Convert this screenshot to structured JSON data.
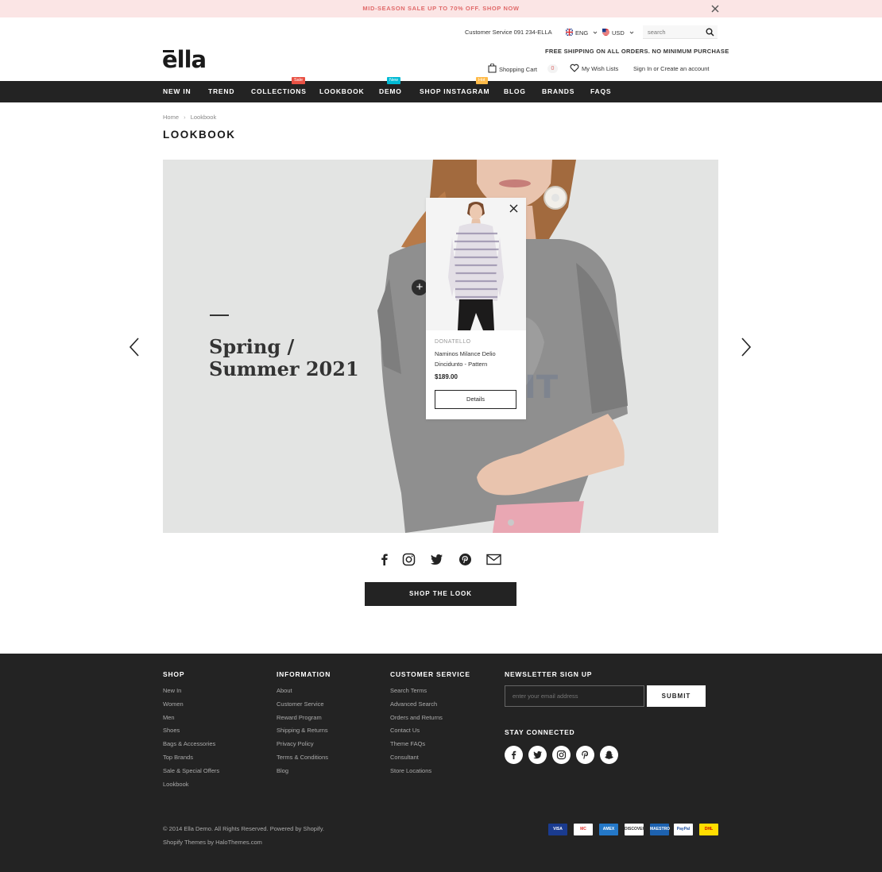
{
  "promo": {
    "text": "MID-SEASON SALE UP TO 70% OFF. SHOP NOW"
  },
  "header": {
    "customer_service": "Customer Service 091 234-ELLA",
    "language": "ENG",
    "currency": "USD",
    "search_placeholder": "search",
    "free_shipping": "FREE SHIPPING ON ALL ORDERS. NO MINIMUM PURCHASE",
    "logo": "ella",
    "cart_label": "Shopping Cart",
    "cart_count": "0",
    "wishlist_label": "My Wish Lists",
    "account_label": "Sign In or Create an account"
  },
  "nav": {
    "items": [
      {
        "label": "NEW IN"
      },
      {
        "label": "TREND"
      },
      {
        "label": "COLLECTIONS",
        "badge": "Sale",
        "badge_color": "#e95144"
      },
      {
        "label": "LOOKBOOK"
      },
      {
        "label": "DEMO",
        "badge": "New",
        "badge_color": "#01bad4"
      },
      {
        "label": "SHOP INSTAGRAM",
        "badge": "Hot",
        "badge_color": "#ffbb49"
      },
      {
        "label": "BLOG"
      },
      {
        "label": "BRANDS"
      },
      {
        "label": "FAQS"
      }
    ]
  },
  "breadcrumb": {
    "home": "Home",
    "current": "Lookbook"
  },
  "page_title": "LOOKBOOK",
  "hero": {
    "title": "Spring /\nSummer 2021"
  },
  "popup": {
    "vendor": "DONATELLO",
    "name": "Naminos Milance Delio Dincidunto - Pattern",
    "price": "$189.00",
    "details_label": "Details"
  },
  "shop_look_label": "SHOP THE LOOK",
  "footer": {
    "columns": [
      {
        "title": "SHOP",
        "links": [
          "New In",
          "Women",
          "Men",
          "Shoes",
          "Bags & Accessories",
          "Top Brands",
          "Sale & Special Offers",
          "Lookbook"
        ]
      },
      {
        "title": "INFORMATION",
        "links": [
          "About",
          "Customer Service",
          "Reward Program",
          "Shipping & Returns",
          "Privacy Policy",
          "Terms & Conditions",
          "Blog"
        ]
      },
      {
        "title": "CUSTOMER SERVICE",
        "links": [
          "Search Terms",
          "Advanced Search",
          "Orders and Returns",
          "Contact Us",
          "Theme FAQs",
          "Consultant",
          "Store Locations"
        ]
      }
    ],
    "newsletter_title": "NEWSLETTER SIGN UP",
    "newsletter_placeholder": "enter your email address",
    "submit_label": "SUBMIT",
    "stay_connected": "STAY CONNECTED",
    "copyright": "© 2014 Ella Demo. All Rights Reserved. Powered by Shopify.",
    "credit": "Shopify Themes by HaloThemes.com",
    "payments": [
      {
        "name": "VISA",
        "bg": "#1a3b8f",
        "fg": "#ffffff"
      },
      {
        "name": "MC",
        "bg": "#ffffff",
        "fg": "#e3342f"
      },
      {
        "name": "AMEX",
        "bg": "#2478c8",
        "fg": "#ffffff"
      },
      {
        "name": "DISCOVER",
        "bg": "#ffffff",
        "fg": "#333333"
      },
      {
        "name": "MAESTRO",
        "bg": "#1d62b0",
        "fg": "#ffffff"
      },
      {
        "name": "PayPal",
        "bg": "#ffffff",
        "fg": "#1d4fa0"
      },
      {
        "name": "DHL",
        "bg": "#ffdd00",
        "fg": "#cc0000"
      }
    ]
  },
  "colors": {
    "accent": "#e06a6a",
    "dark": "#232323"
  }
}
